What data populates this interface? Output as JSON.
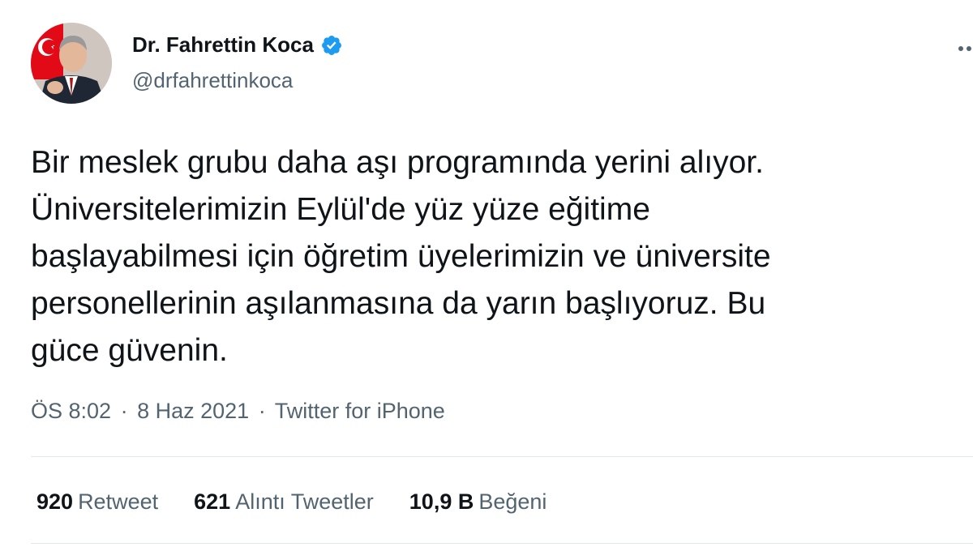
{
  "user": {
    "display_name": "Dr. Fahrettin Koca",
    "handle": "@drfahrettinkoca",
    "verified": true
  },
  "tweet": {
    "lines": [
      "Bir meslek grubu daha aşı programında yerini alıyor.",
      "Üniversitelerimizin Eylül'de yüz yüze eğitime",
      "başlayabilmesi için öğretim üyelerimizin ve üniversite",
      "personellerinin aşılanmasına da yarın başlıyoruz. Bu",
      "güce güvenin."
    ],
    "time": "ÖS 8:02",
    "date": "8 Haz 2021",
    "separator": "·",
    "source": "Twitter for iPhone"
  },
  "stats": {
    "retweets": {
      "count": "920",
      "label": "Retweet"
    },
    "quotes": {
      "count": "621",
      "label": "Alıntı Tweetler"
    },
    "likes": {
      "count": "10,9 B",
      "label": "Beğeni"
    }
  },
  "colors": {
    "text": "#0f1419",
    "secondary": "#536471",
    "verified_blue": "#1d9bf0",
    "divider": "#e1e8ed",
    "flag_red": "#e30a17"
  },
  "icons": {
    "verified": "verified-badge-icon",
    "more": "more-options-icon"
  }
}
